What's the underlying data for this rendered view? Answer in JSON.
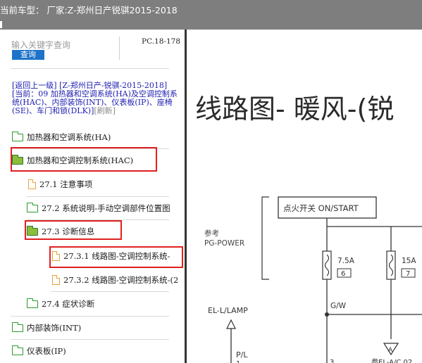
{
  "header": {
    "title": "当前车型： 厂家:Z-郑州日产锐骐2015-2018"
  },
  "search": {
    "placeholder": "输入关键字查询",
    "button_label": "查询",
    "page_code": "PC.18-178"
  },
  "nav": {
    "back_link": "[返回上一级]",
    "model_link": "[Z-郑州日产-锐骐-2015-2018]",
    "current_prefix": "[当前：",
    "current_path": "09 加热器和空调系统(HA)及空调控制系统(HAC)、内部装饰(INT)、仪表板(IP)、座椅(SE)、车门和锁(DLK)]",
    "refresh": "[刷新]"
  },
  "tree": {
    "items": [
      {
        "label": "加热器和空调系统(HA)",
        "icon": "folder-icon"
      },
      {
        "label": "加热器和空调控制系统(HAC)",
        "icon": "folder-open-icon"
      },
      {
        "label": "27.1 注意事项",
        "icon": "document-icon"
      },
      {
        "label": "27.2 系统说明-手动空调部件位置图",
        "icon": "folder-icon"
      },
      {
        "label": "27.3 诊断信息",
        "icon": "folder-open-icon"
      },
      {
        "label": "27.3.1 线路图-空调控制系统-",
        "icon": "document-icon"
      },
      {
        "label": "27.3.2 线路图-空调控制系统-(2",
        "icon": "document-icon"
      },
      {
        "label": "27.4 症状诊断",
        "icon": "folder-icon"
      },
      {
        "label": "内部装饰(INT)",
        "icon": "folder-icon"
      },
      {
        "label": "仪表板(IP)",
        "icon": "folder-icon"
      }
    ]
  },
  "diagram": {
    "title": "线路图- 暖风-(锐",
    "ignition_label": "点火开关 ON/START",
    "ref_label": "参考",
    "ref_value": "PG-POWER",
    "fuse1_rating": "7.5A",
    "fuse1_number": "6",
    "fuse2_rating": "15A",
    "fuse2_number": "7",
    "wire_color": "G/W",
    "lamp_label": "EL-L/LAMP",
    "connector_label": "P/L",
    "connector_pin": "1",
    "pin3": "3",
    "terminal_a": "A",
    "bottom_label": "参EL-A/C 02"
  },
  "colors": {
    "header_bg": "#7e7e7e",
    "highlight": "#e02020",
    "link": "#1c1cb0",
    "button": "#1e73c8"
  }
}
